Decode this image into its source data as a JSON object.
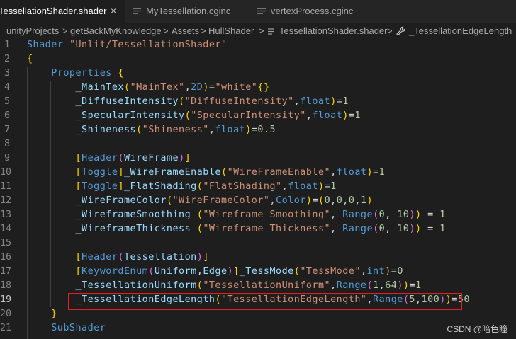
{
  "tabs": [
    {
      "label": "TessellationShader.shader",
      "close": "×",
      "icon": "close-icon"
    },
    {
      "label": "MyTessellation.cginc",
      "icon": "file-cginc-icon"
    },
    {
      "label": "vertexProcess.cginc",
      "icon": "file-cginc-icon"
    }
  ],
  "breadcrumb": {
    "items": [
      "unityProjects",
      "getBackMyKnowledge",
      "Assets",
      "HullShader",
      "TessellationShader.shader",
      "_TessellationEdgeLength"
    ],
    "separator": ">",
    "symbol_icon": "wrench-icon"
  },
  "editor": {
    "current_line": 19,
    "lines": [
      {
        "n": "1",
        "text": "Shader \"Unlit/TessellationShader\""
      },
      {
        "n": "2",
        "text": "{"
      },
      {
        "n": "3",
        "text": "    Properties {"
      },
      {
        "n": "4",
        "text": "        _MainTex(\"MainTex\",2D)=\"white\"{}"
      },
      {
        "n": "5",
        "text": "        _DiffuseIntensity(\"DiffuseIntensity\",float)=1"
      },
      {
        "n": "6",
        "text": "        _SpecularIntensity(\"SpecularIntensity\",float)=1"
      },
      {
        "n": "7",
        "text": "        _Shineness(\"Shineness\",float)=0.5"
      },
      {
        "n": "8",
        "text": ""
      },
      {
        "n": "9",
        "text": "        [Header(WireFrame)]"
      },
      {
        "n": "10",
        "text": "        [Toggle]_WireFrameEnable(\"WireFrameEnable\",float)=1"
      },
      {
        "n": "11",
        "text": "        [Toggle]_FlatShading(\"FlatShading\",float)=1"
      },
      {
        "n": "12",
        "text": "        _WireFrameColor(\"WireFrameColor\",Color)=(0,0,0,1)"
      },
      {
        "n": "13",
        "text": "        _WireframeSmoothing (\"Wireframe Smoothing\", Range(0, 10)) = 1"
      },
      {
        "n": "14",
        "text": "        _WireframeThickness (\"Wireframe Thickness\", Range(0, 10)) = 1"
      },
      {
        "n": "15",
        "text": ""
      },
      {
        "n": "16",
        "text": "        [Header(Tessellation)]"
      },
      {
        "n": "17",
        "text": "        [KeywordEnum(Uniform,Edge)]_TessMode(\"TessMode\",int)=0"
      },
      {
        "n": "18",
        "text": "        _TessellationUniform(\"TessellationUniform\",Range(1,64))=1"
      },
      {
        "n": "19",
        "text": "        _TessellationEdgeLength(\"TessellationEdgeLength\",Range(5,100))=50"
      },
      {
        "n": "20",
        "text": "    }"
      },
      {
        "n": "21",
        "text": "    SubShader"
      }
    ]
  },
  "watermark": "CSDN @暗色瞳",
  "colors": {
    "background": "#1e1e1e",
    "highlight_box": "#e51f1f",
    "keyword": "#569cd6",
    "string": "#ce9178",
    "number": "#b5cea8"
  }
}
